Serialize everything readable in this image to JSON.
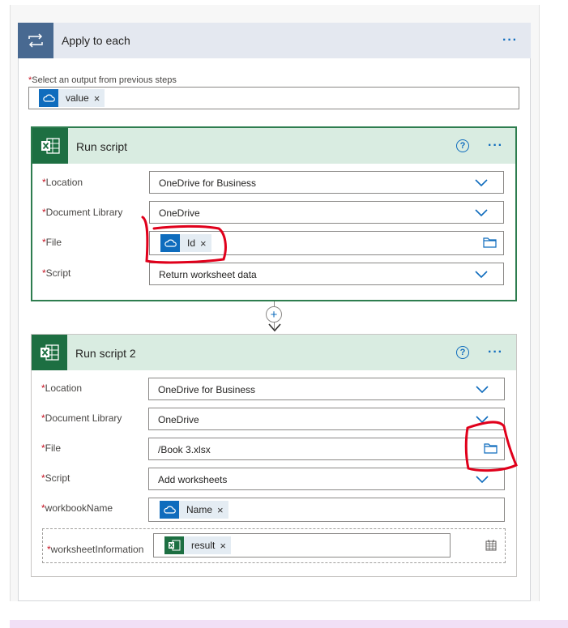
{
  "apply_to_each": {
    "title": "Apply to each",
    "more": "···",
    "select_label": "Select an output from previous steps",
    "token": {
      "label": "value",
      "remove": "×",
      "icon": "onedrive-icon"
    }
  },
  "run_script": {
    "title": "Run script",
    "help": "?",
    "more": "···",
    "fields": {
      "location": {
        "label": "Location",
        "value": "OneDrive for Business"
      },
      "library": {
        "label": "Document Library",
        "value": "OneDrive"
      },
      "file": {
        "label": "File",
        "token": "Id",
        "remove": "×"
      },
      "script": {
        "label": "Script",
        "value": "Return worksheet data"
      }
    }
  },
  "run_script_2": {
    "title": "Run script 2",
    "help": "?",
    "more": "···",
    "fields": {
      "location": {
        "label": "Location",
        "value": "OneDrive for Business"
      },
      "library": {
        "label": "Document Library",
        "value": "OneDrive"
      },
      "file": {
        "label": "File",
        "value": "/Book 3.xlsx"
      },
      "script": {
        "label": "Script",
        "value": "Add worksheets"
      },
      "workbook_name": {
        "label": "workbookName",
        "token": "Name",
        "remove": "×"
      },
      "worksheet_info": {
        "label": "worksheetInformation",
        "token": "result",
        "remove": "×"
      }
    }
  },
  "required_mark": "*",
  "colors": {
    "accent": "#0f6cbd",
    "excel_green": "#1d6f42",
    "loop_blue": "#486991",
    "annotation_red": "#e0001b"
  }
}
